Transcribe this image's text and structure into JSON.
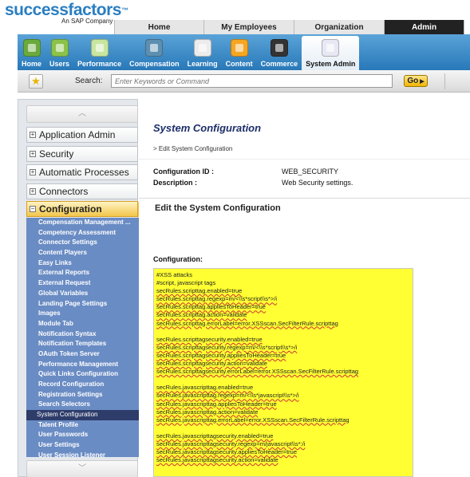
{
  "brand": {
    "name": "successfactors",
    "tm": "™",
    "tagline": "An SAP Company"
  },
  "topnav": [
    {
      "label": "Home",
      "active": false
    },
    {
      "label": "My Employees",
      "active": false
    },
    {
      "label": "Organization",
      "active": false
    },
    {
      "label": "Admin",
      "active": true
    }
  ],
  "modules": [
    {
      "label": "Home",
      "icon": "home-icon"
    },
    {
      "label": "Users",
      "icon": "users-icon"
    },
    {
      "label": "Performance",
      "icon": "performance-icon"
    },
    {
      "label": "Compensation",
      "icon": "compensation-icon"
    },
    {
      "label": "Learning",
      "icon": "learning-icon"
    },
    {
      "label": "Content",
      "icon": "content-icon"
    },
    {
      "label": "Commerce",
      "icon": "commerce-icon"
    },
    {
      "label": "System Admin",
      "icon": "system-admin-icon"
    }
  ],
  "search": {
    "label": "Search:",
    "placeholder": "Enter Keywords or Command",
    "go": "Go"
  },
  "sidebar": {
    "sections": [
      {
        "label": "Application Admin",
        "toggle": "+"
      },
      {
        "label": "Security",
        "toggle": "+"
      },
      {
        "label": "Automatic Processes",
        "toggle": "+"
      },
      {
        "label": "Connectors",
        "toggle": "+"
      },
      {
        "label": "Configuration",
        "toggle": "−"
      }
    ],
    "items": [
      "Compensation Management ...",
      "Competency Assessment",
      "Connector Settings",
      "Content Players",
      "Easy Links",
      "External Reports",
      "External Request",
      "Global Variables",
      "Landing Page Settings",
      "Images",
      "Module Tab",
      "Notification Syntax",
      "Notification Templates",
      "OAuth Token Server",
      "Performance Management",
      "Quick Links Configuration",
      "Record Configuration",
      "Registration Settings",
      "Search Selectors",
      "System Configuration",
      "Talent Profile",
      "User Passwords",
      "User Settings",
      "User Session Listener"
    ],
    "selected_item": "System Configuration"
  },
  "main": {
    "title": "System Configuration",
    "breadcrumb": "> Edit System Configuration",
    "config_id_label": "Configuration ID :",
    "config_id_value": "WEB_SECURITY",
    "description_label": "Description :",
    "description_value": "Web Security settings.",
    "section_heading": "Edit the System Configuration",
    "configuration_label": "Configuration:",
    "code_lines": [
      "#XSS attacks",
      "#script, javascript tags",
      "secRules.scripttag.enabled=true",
      "secRules.scripttag.regexp=m/<\\\\s*script\\\\s*>/i",
      "secRules.scripttag.appliesToHeader=true",
      "secRules.scripttag.action=validate",
      "secRules.scripttag.errorLabel=error.XSSscan.SecFilterRule.scripttag",
      "",
      "secRules.scripttagsecurity.enabled=true",
      "secRules.scripttagsecurity.regexp=m/<\\\\s*script\\\\s*>/i",
      "secRules.scripttagsecurity.appliesToHeader=true",
      "secRules.scripttagsecurity.action=validate",
      "secRules.scripttagsecurity.errorLabel=error.XSSscan.SecFilterRule.scripttag",
      "",
      "secRules.javascripttag.enabled=true",
      "secRules.javascripttag.regexp=m/<\\\\s*javascript\\\\s*>/i",
      "secRules.javascripttag.appliesToHeader=true",
      "secRules.javascripttag.action=validate",
      "secRules.javascripttag.errorLabel=error.XSSscan.SecFilterRule.scripttag",
      "",
      "secRules.javascripttagsecurity.enabled=true",
      "secRules.javascripttagsecurity.regexp=m/javascript\\\\s*:/i",
      "secRules.javascripttagsecurity.appliesToHeader=true",
      "secRules.javascripttagsecurity.action=validate"
    ]
  },
  "colors": {
    "brand_blue": "#2a7ec1",
    "module_bar": "#3b8ccb",
    "sidebar_list": "#6a8cc4",
    "sidebar_selected": "#2e3c6a",
    "code_bg": "#ffff33",
    "title": "#1d2f6a"
  }
}
